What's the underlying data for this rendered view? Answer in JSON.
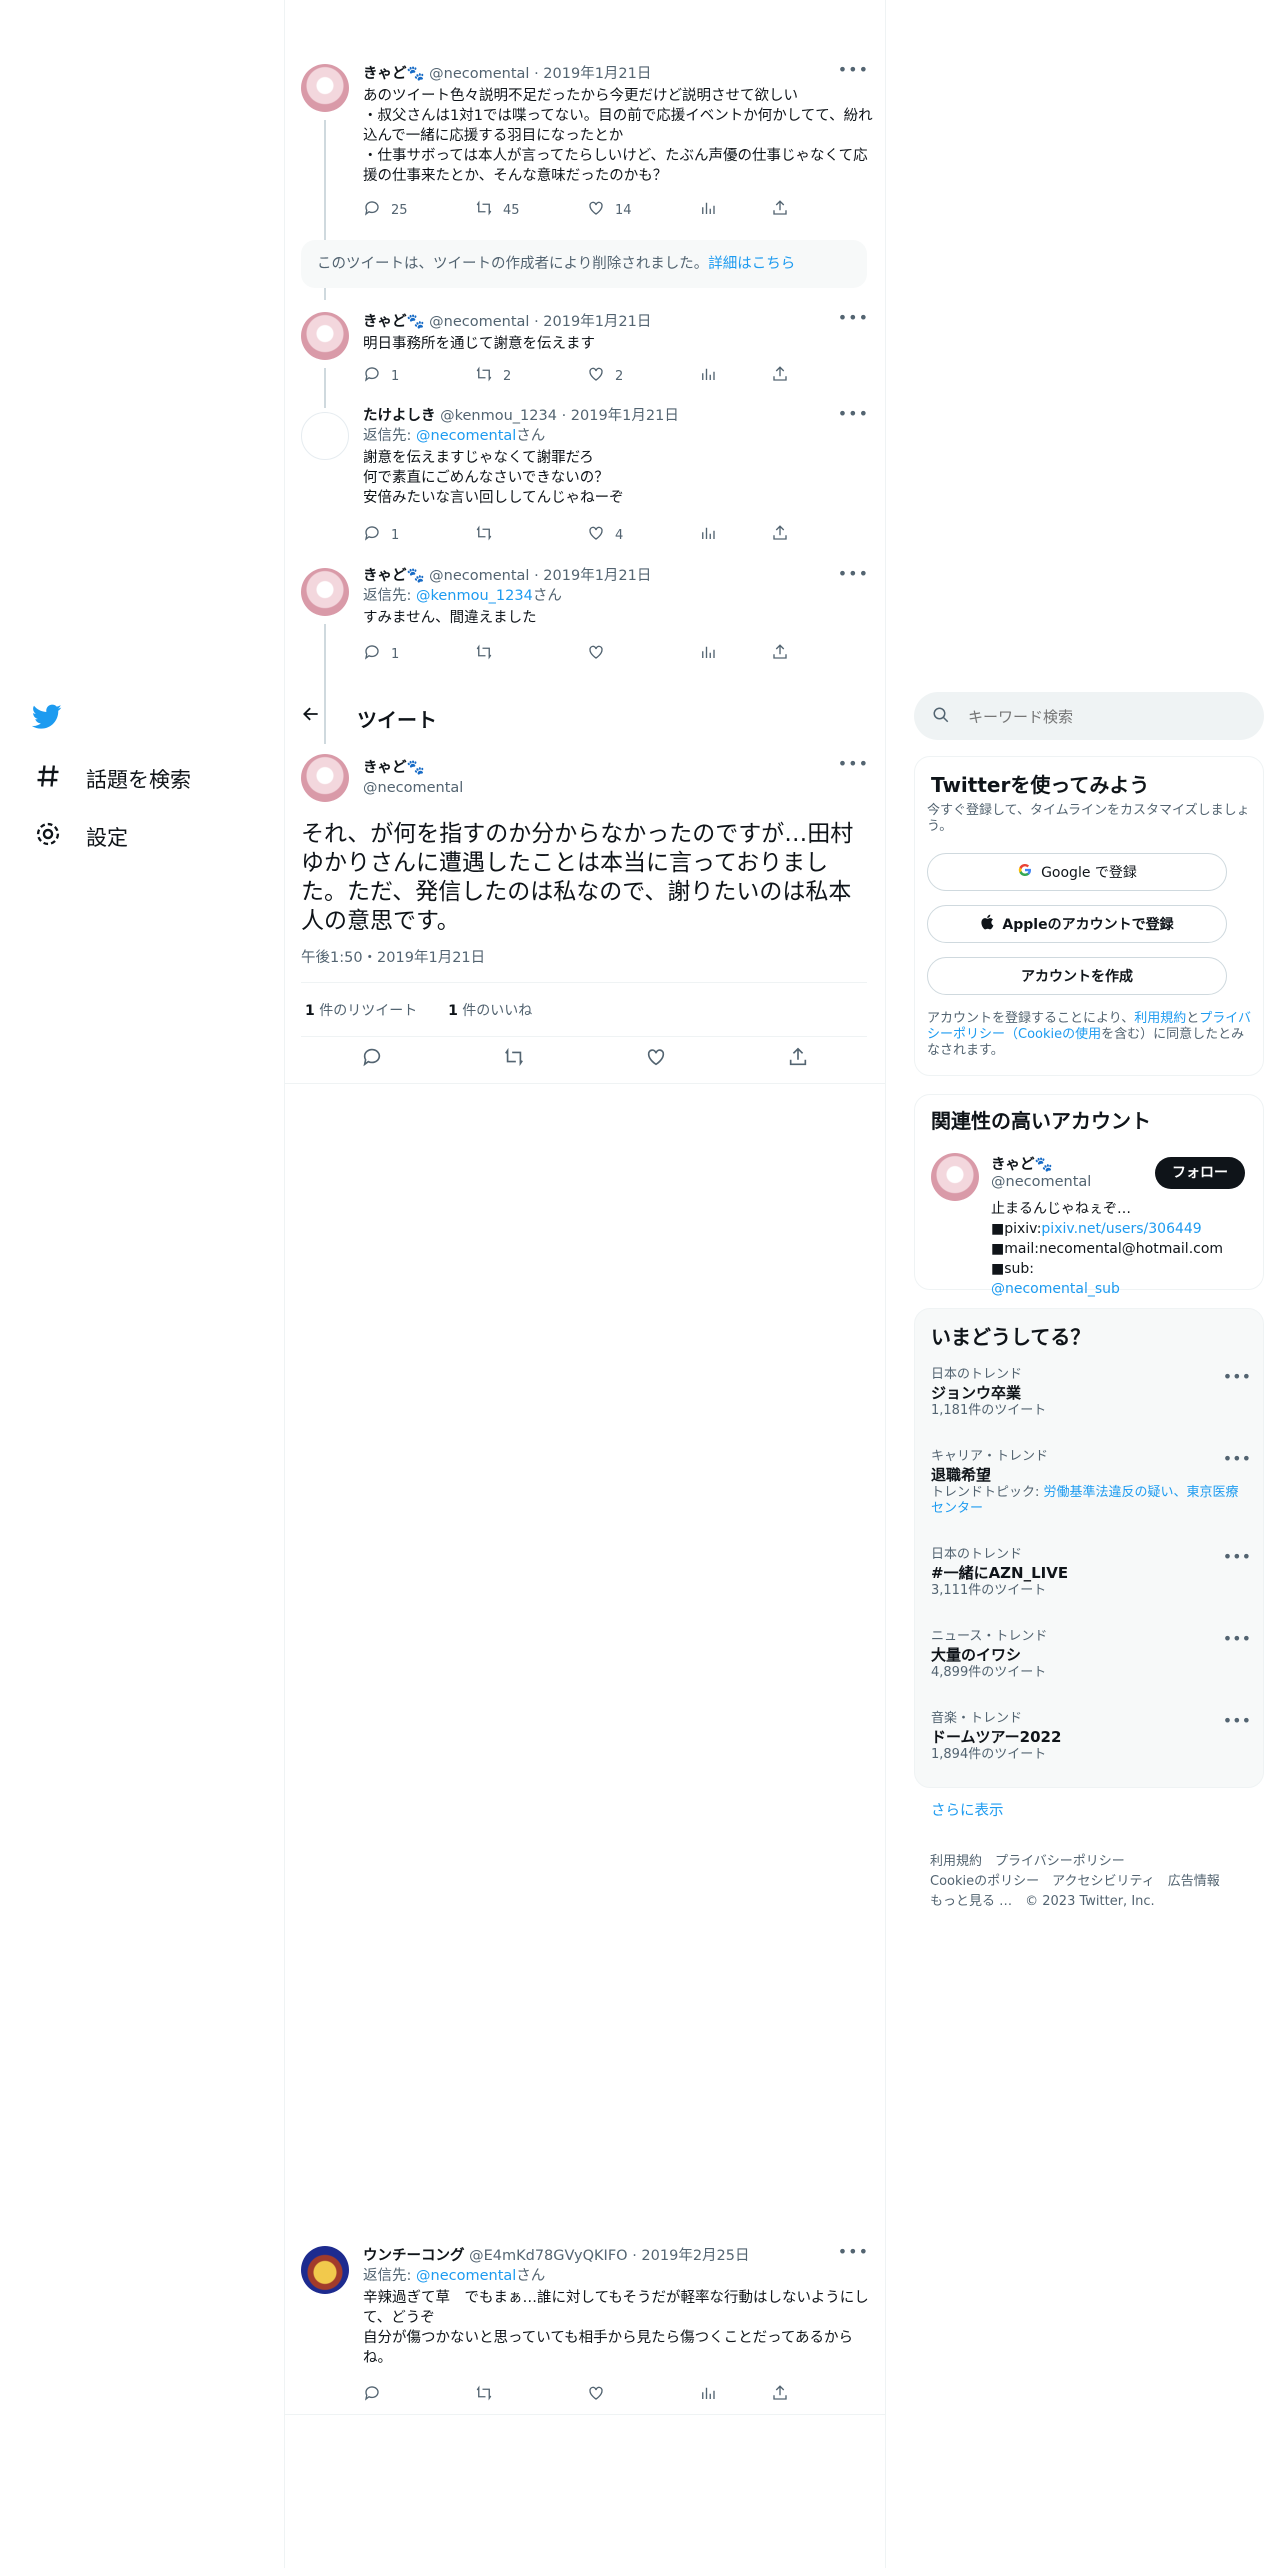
{
  "nav": {
    "explore_label": "話題を検索",
    "settings_label": "設定"
  },
  "thread": [
    {
      "name": "きゃど🐾",
      "handle": "@necomental",
      "date": "2019年1月21日",
      "text": "あのツイート色々説明不足だったから今更だけど説明させて欲しい\n・叔父さんは1対1では喋ってない。目の前で応援イベントか何かしてて、紛れ込んで一緒に応援する羽目になったとか\n・仕事サボっては本人が言ってたらしいけど、たぶん声優の仕事じゃなくて応援の仕事来たとか、そんな意味だったのかも？",
      "replies": "25",
      "retweets": "45",
      "likes": "14"
    },
    {
      "name": "きゃど🐾",
      "handle": "@necomental",
      "date": "2019年1月21日",
      "text": "明日事務所を通じて謝意を伝えます",
      "replies": "1",
      "retweets": "2",
      "likes": "2"
    },
    {
      "name": "たけよしき",
      "handle": "@kenmou_1234",
      "date": "2019年1月21日",
      "reply_prefix": "返信先: ",
      "reply_to": "@necomental",
      "reply_suffix": "さん",
      "text": "謝意を伝えますじゃなくて謝罪だろ\n何で素直にごめんなさいできないの？\n安倍みたいな言い回ししてんじゃねーぞ",
      "replies": "1",
      "retweets": "",
      "likes": "4"
    },
    {
      "name": "きゃど🐾",
      "handle": "@necomental",
      "date": "2019年1月21日",
      "reply_prefix": "返信先: ",
      "reply_to": "@kenmou_1234",
      "reply_suffix": "さん",
      "text": "すみません、間違えました",
      "replies": "1",
      "retweets": "",
      "likes": ""
    }
  ],
  "deleted_notice": {
    "text": "このツイートは、ツイートの作成者により削除されました。",
    "link": "詳細はこちら"
  },
  "header": {
    "title": "ツイート"
  },
  "focus_tweet": {
    "name": "きゃど🐾",
    "handle": "@necomental",
    "text": "それ、が何を指すのか分からなかったのですが…田村ゆかりさんに遭遇したことは本当に言っておりました。ただ、発信したのは私なので、謝りたいのは私本人の意思です。",
    "time": "午後1:50・2019年1月21日",
    "retweet_count": "1",
    "retweet_label": " 件のリツイート",
    "like_count": "1",
    "like_label": " 件のいいね"
  },
  "bottom_reply": {
    "name": "ウンチーコング",
    "handle": "@E4mKd78GVyQKIFO",
    "date": "2019年2月25日",
    "reply_prefix": "返信先: ",
    "reply_to": "@necomental",
    "reply_suffix": "さん",
    "text": "辛辣過ぎて草　でもまぁ…誰に対してもそうだが軽率な行動はしないようにして、どうぞ\n自分が傷つかないと思っていても相手から見たら傷つくことだってあるからね。"
  },
  "search": {
    "placeholder": "キーワード検索"
  },
  "signup": {
    "title": "Twitterを使ってみよう",
    "subtitle": "今すぐ登録して、タイムラインをカスタマイズしましょう。",
    "google_button": "Google で登録",
    "apple_button": "Appleのアカウントで登録",
    "create_button": "アカウントを作成",
    "terms_prefix": "アカウントを登録することにより、",
    "terms_link": "利用規約",
    "terms_and": "と",
    "privacy_link": "プライバシーポリシー（Cookieの使用",
    "terms_suffix": "を含む）に同意したとみなされます。"
  },
  "related": {
    "title": "関連性の高いアカウント",
    "name": "きゃど🐾",
    "handle": "@necomental",
    "follow_button": "フォロー",
    "bio_line1": "止まるんじゃねぇぞ…",
    "bio_pixiv_prefix": "■pixiv:",
    "bio_pixiv_link": "pixiv.net/users/306449",
    "bio_mail": "■mail:necomental@hotmail.com ■sub:",
    "bio_sub_link": "@necomental_sub"
  },
  "trends": {
    "title": "いまどうしてる？",
    "items": [
      {
        "category": "日本のトレンド",
        "topic": "ジョンウ卒業",
        "count": "1,181件のツイート"
      },
      {
        "category": "キャリア・トレンド",
        "topic": "退職希望",
        "count": "トレンドトピック: ",
        "related": "労働基準法違反の疑い、東京医療センター"
      },
      {
        "category": "日本のトレンド",
        "topic": "#一緒にAZN_LIVE",
        "count": "3,111件のツイート"
      },
      {
        "category": "ニュース・トレンド",
        "topic": "大量のイワシ",
        "count": "4,899件のツイート"
      },
      {
        "category": "音楽・トレンド",
        "topic": "ドームツアー2022",
        "count": "1,894件のツイート"
      }
    ],
    "show_more": "さらに表示"
  },
  "footer": {
    "line1": "利用規約　プライバシーポリシー",
    "line2": "Cookieのポリシー　アクセシビリティ　広告情報",
    "line3": "もっと見る …　© 2023 Twitter, Inc."
  },
  "colors": {
    "accent": "#1d9bf0",
    "text": "#0f1419",
    "muted": "#536471"
  }
}
